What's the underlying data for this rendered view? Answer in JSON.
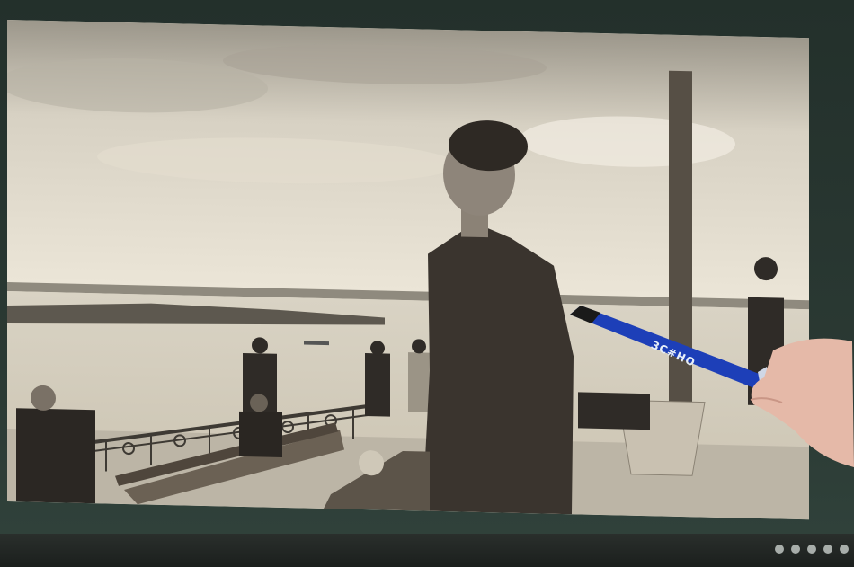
{
  "photo": {
    "description_icon": "black-and-white-riverside-photograph"
  },
  "pen": {
    "brand_text": "ЗС#НО"
  },
  "colors": {
    "screen_tone": "#e8e1d2",
    "monitor_bezel": "#23302b",
    "pen_blue": "#1d3fb8"
  }
}
